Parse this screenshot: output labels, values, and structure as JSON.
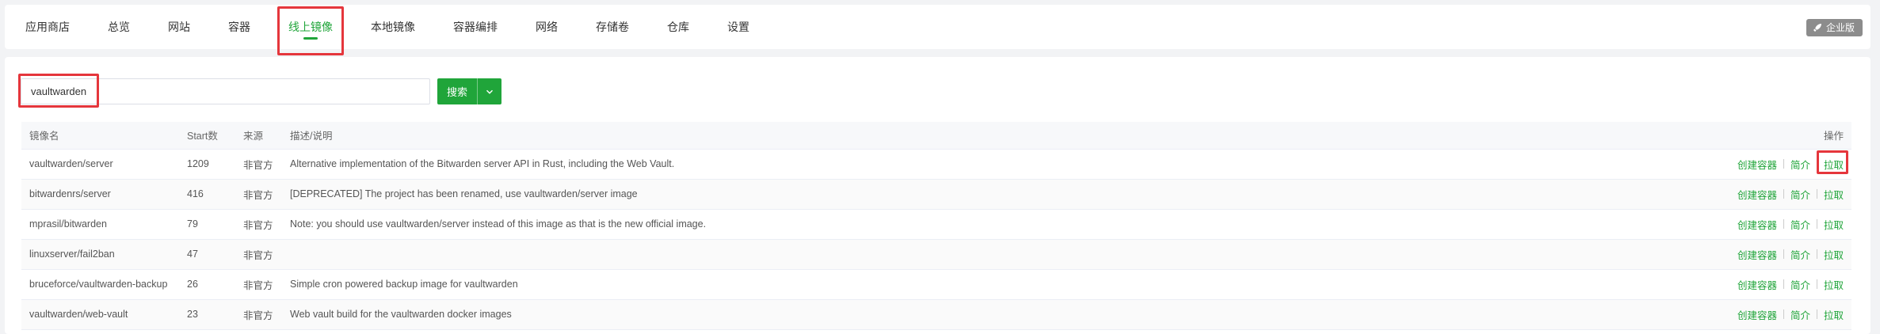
{
  "nav": {
    "tabs": [
      "应用商店",
      "总览",
      "网站",
      "容器",
      "线上镜像",
      "本地镜像",
      "容器编排",
      "网络",
      "存储卷",
      "仓库",
      "设置"
    ],
    "active": "线上镜像",
    "badge": "企业版"
  },
  "search": {
    "value": "vaultwarden",
    "button_label": "搜索"
  },
  "table": {
    "headers": {
      "name": "镜像名",
      "stars": "Start数",
      "source": "来源",
      "desc": "描述/说明",
      "ops": "操作"
    },
    "rows": [
      {
        "name": "vaultwarden/server",
        "stars": "1209",
        "source": "非官方",
        "desc": "Alternative implementation of the Bitwarden server API in Rust, including the Web Vault."
      },
      {
        "name": "bitwardenrs/server",
        "stars": "416",
        "source": "非官方",
        "desc": "[DEPRECATED] The project has been renamed, use vaultwarden/server image"
      },
      {
        "name": "mprasil/bitwarden",
        "stars": "79",
        "source": "非官方",
        "desc": "Note: you should use vaultwarden/server instead of this image as that is the new official image."
      },
      {
        "name": "linuxserver/fail2ban",
        "stars": "47",
        "source": "非官方",
        "desc": ""
      },
      {
        "name": "bruceforce/vaultwarden-backup",
        "stars": "26",
        "source": "非官方",
        "desc": "Simple cron powered backup image for vaultwarden"
      },
      {
        "name": "vaultwarden/web-vault",
        "stars": "23",
        "source": "非官方",
        "desc": "Web vault build for the vaultwarden docker images"
      }
    ],
    "actions": {
      "create": "创建容器",
      "intro": "简介",
      "pull": "拉取"
    }
  },
  "colors": {
    "accent": "#20a53a",
    "highlight": "#e5363c",
    "badge_bg": "#8c8c8c"
  }
}
